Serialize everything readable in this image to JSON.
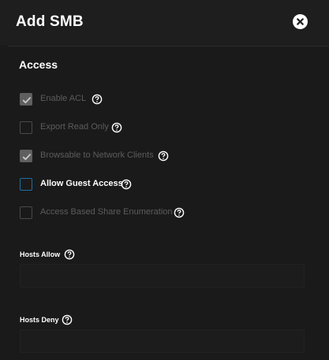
{
  "header": {
    "title": "Add SMB",
    "close_icon": "close-icon"
  },
  "access": {
    "section_title": "Access",
    "options": [
      {
        "label": "Enable ACL",
        "checked": true,
        "enabled": false
      },
      {
        "label": "Export Read Only",
        "checked": false,
        "enabled": false
      },
      {
        "label": "Browsable to Network Clients",
        "checked": true,
        "enabled": false
      },
      {
        "label": "Allow Guest Access",
        "checked": false,
        "enabled": true
      },
      {
        "label": "Access Based Share Enumeration",
        "checked": false,
        "enabled": false
      }
    ]
  },
  "hosts_allow": {
    "label": "Hosts Allow",
    "value": ""
  },
  "hosts_deny": {
    "label": "Hosts Deny",
    "value": ""
  },
  "colors": {
    "background": "#1a1a1a",
    "header": "#1e1e1e",
    "focus_border": "#1e6fa5",
    "disabled_text": "#5c5c5c"
  }
}
